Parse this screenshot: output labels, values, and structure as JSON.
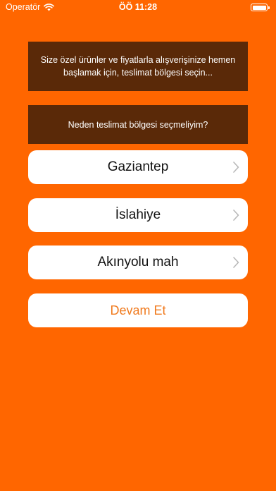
{
  "status_bar": {
    "carrier": "Operatör",
    "time": "ÖÖ 11:28"
  },
  "intro": {
    "text": "Size özel ürünler ve fiyatlarla alışverişinize hemen başlamak için, teslimat bölgesi seçin..."
  },
  "why_box": {
    "text": "Neden teslimat bölgesi seçmeliyim?"
  },
  "selections": [
    {
      "label": "Gaziantep",
      "icon": "chevron-right-icon"
    },
    {
      "label": "İslahiye",
      "icon": "chevron-right-icon"
    },
    {
      "label": "Akınyolu mah",
      "icon": "chevron-right-icon"
    }
  ],
  "continue_button": {
    "label": "Devam Et"
  },
  "colors": {
    "background": "#FF6600",
    "info_box": "#5A2908",
    "row": "#FFFFFF",
    "accent_text": "#F07A1E"
  }
}
